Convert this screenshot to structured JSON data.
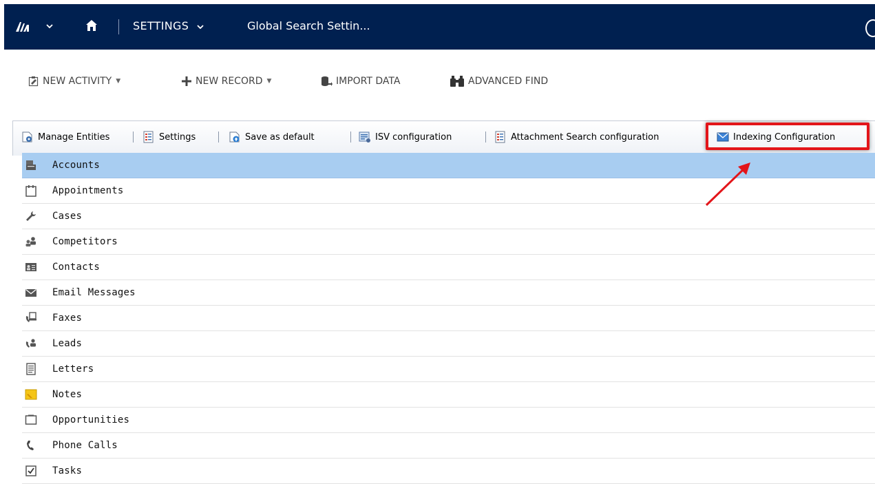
{
  "navbar": {
    "area_label": "SETTINGS",
    "page_title": "Global Search Settin...",
    "background": "#002050"
  },
  "command_bar": {
    "new_activity": "NEW ACTIVITY",
    "new_record": "NEW RECORD",
    "import_data": "IMPORT DATA",
    "advanced_find": "ADVANCED FIND"
  },
  "toolbar": {
    "manage_entities": "Manage Entities",
    "settings": "Settings",
    "save_as_default": "Save as default",
    "isv_configuration": "ISV configuration",
    "attachment_search_configuration": "Attachment Search configuration",
    "indexing_configuration": "Indexing Configuration"
  },
  "entities": [
    {
      "label": "Accounts",
      "icon": "accounts-icon",
      "selected": true
    },
    {
      "label": "Appointments",
      "icon": "appointment-icon",
      "selected": false
    },
    {
      "label": "Cases",
      "icon": "wrench-icon",
      "selected": false
    },
    {
      "label": "Competitors",
      "icon": "competitors-icon",
      "selected": false
    },
    {
      "label": "Contacts",
      "icon": "contact-card-icon",
      "selected": false
    },
    {
      "label": "Email Messages",
      "icon": "email-icon",
      "selected": false
    },
    {
      "label": "Faxes",
      "icon": "fax-icon",
      "selected": false
    },
    {
      "label": "Leads",
      "icon": "leads-icon",
      "selected": false
    },
    {
      "label": "Letters",
      "icon": "letter-icon",
      "selected": false
    },
    {
      "label": "Notes",
      "icon": "note-icon",
      "selected": false
    },
    {
      "label": "Opportunities",
      "icon": "opportunity-icon",
      "selected": false
    },
    {
      "label": "Phone Calls",
      "icon": "phone-icon",
      "selected": false
    },
    {
      "label": "Tasks",
      "icon": "task-icon",
      "selected": false
    }
  ],
  "colors": {
    "selected_row": "#a8cdf1",
    "highlight": "#e3151a"
  }
}
